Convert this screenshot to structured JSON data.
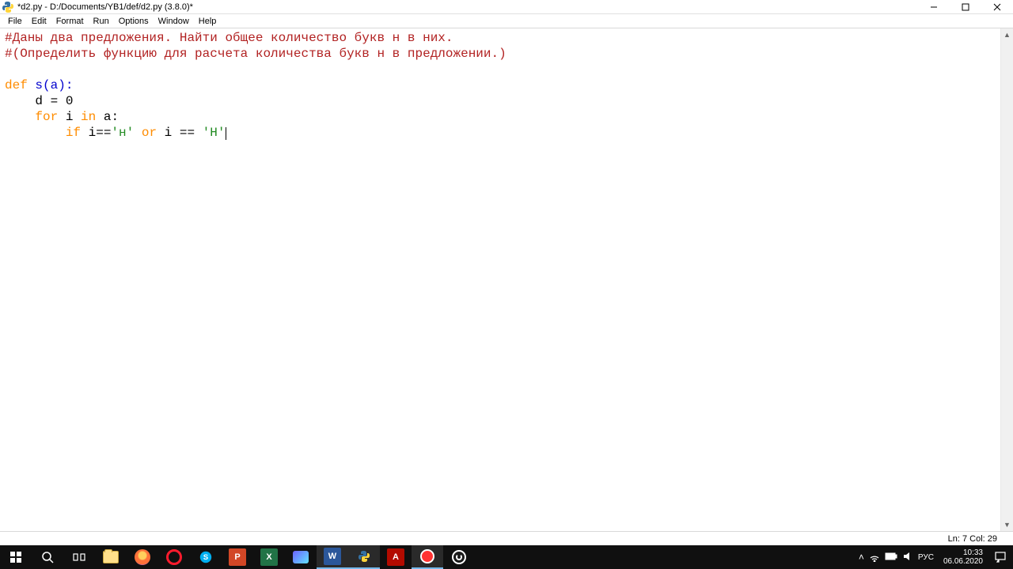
{
  "window": {
    "title": "*d2.py - D:/Documents/YB1/def/d2.py (3.8.0)*"
  },
  "menu": {
    "items": [
      "File",
      "Edit",
      "Format",
      "Run",
      "Options",
      "Window",
      "Help"
    ]
  },
  "code": {
    "line1": "#Даны два предложения. Найти общее количество букв н в них.",
    "line2": "#(Определить функцию для расчета количества букв н в предложении.)",
    "line4_def": "def",
    "line4_name": " s(a):",
    "line5": "    d = 0",
    "line6_for": "    for",
    "line6_i": " i ",
    "line6_in": "in",
    "line6_rest": " a:",
    "line7_if": "        if",
    "line7_a": " i==",
    "line7_s1": "'н'",
    "line7_or": " or ",
    "line7_b": "i == ",
    "line7_s2": "'Н'"
  },
  "status": {
    "text": "Ln: 7  Col: 29"
  },
  "tray": {
    "lang": "РУС",
    "time": "10:33",
    "date": "06.06.2020"
  }
}
